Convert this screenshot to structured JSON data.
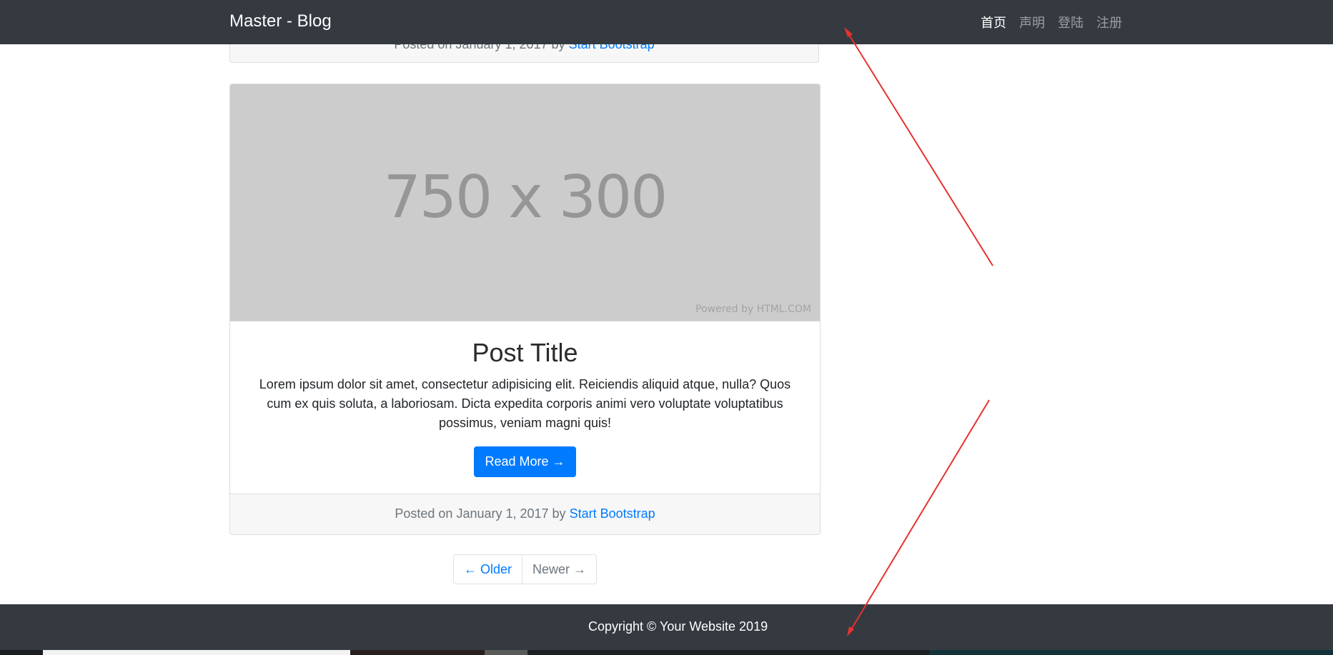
{
  "navbar": {
    "brand": "Master - Blog",
    "links": [
      {
        "label": "首页",
        "active": true
      },
      {
        "label": "声明",
        "active": false
      },
      {
        "label": "登陆",
        "active": false
      },
      {
        "label": "注册",
        "active": false
      }
    ]
  },
  "previous_post_footer": {
    "prefix": "Posted on January 1, 2017 by",
    "author": "Start Bootstrap"
  },
  "post": {
    "image_placeholder": "750 x 300",
    "image_credit": "Powered by HTML.COM",
    "title": "Post Title",
    "text": "Lorem ipsum dolor sit amet, consectetur adipisicing elit. Reiciendis aliquid atque, nulla? Quos cum ex quis soluta, a laboriosam. Dicta expedita corporis animi vero voluptate voluptatibus possimus, veniam magni quis!",
    "read_more": "Read More →",
    "footer_prefix": "Posted on January 1, 2017 by",
    "footer_author": "Start Bootstrap"
  },
  "pagination": {
    "older": "← Older",
    "newer": "Newer →"
  },
  "footer": {
    "copyright": "Copyright © Your Website 2019"
  },
  "colors": {
    "navbar_bg": "#343a40",
    "primary": "#007bff",
    "annotation": "#e8312f"
  }
}
